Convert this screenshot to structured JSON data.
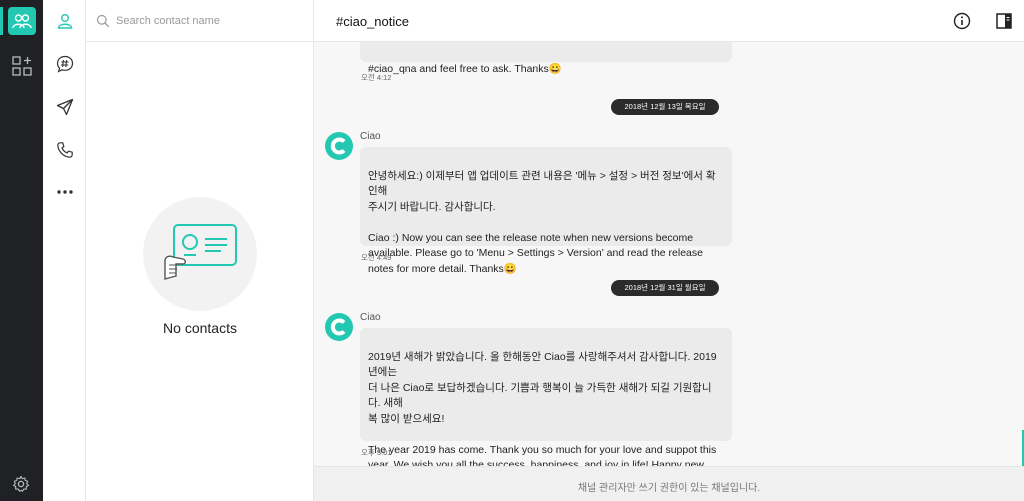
{
  "colors": {
    "accent": "#23c8b3",
    "rail": "#1f2124",
    "bubble": "#ebebeb",
    "date_pill": "#2b2b2b"
  },
  "rail": {
    "icons": [
      "contacts-app-icon",
      "apps-grid-icon",
      "settings-gear-icon"
    ]
  },
  "nav": {
    "items": [
      "person-icon",
      "channel-hash-icon",
      "send-icon",
      "phone-icon",
      "more-icon"
    ]
  },
  "contacts": {
    "search_placeholder": "Search contact name",
    "empty_text": "No contacts"
  },
  "header": {
    "title": "#ciao_notice"
  },
  "messages": {
    "m0": {
      "text": "#ciao_qna and feel free to ask. Thanks😀",
      "time": "오전 4:12"
    },
    "d1": "2018년 12월 13일 목요일",
    "m1": {
      "sender": "Ciao",
      "text": "안녕하세요:)  이제부터 앱 업데이트 관련 내용은 '메뉴 > 설정 > 버전 정보'에서 확인해\n주시기 바랍니다. 감사합니다.\n\nCiao :) Now you can see the release note when new versions become\navailable. Please go to 'Menu > Settings > Version' and read the release\nnotes for more detail. Thanks😀",
      "time": "오전 4:49"
    },
    "d2": "2018년 12월 31일 월요일",
    "m2": {
      "sender": "Ciao",
      "text": "2019년 새해가 밝았습니다. 올 한해동안 Ciao를 사랑해주셔서 감사합니다. 2019년에는\n더 나은 Ciao로 보답하겠습니다. 기쁨과 행복이 늘 가득한 새해가 되길 기원합니다. 새해\n복 많이 받으세요!\n\nThe year 2019 has come. Thank you so much for your love and suppot this\nyear. We wish you all the success, happiness, and joy in life! Happy new year\nwith Ciao 😀",
      "time": "오후 5:01"
    }
  },
  "footer": {
    "text": "채널 관리자만 쓰기 권한이 있는 채널입니다."
  }
}
